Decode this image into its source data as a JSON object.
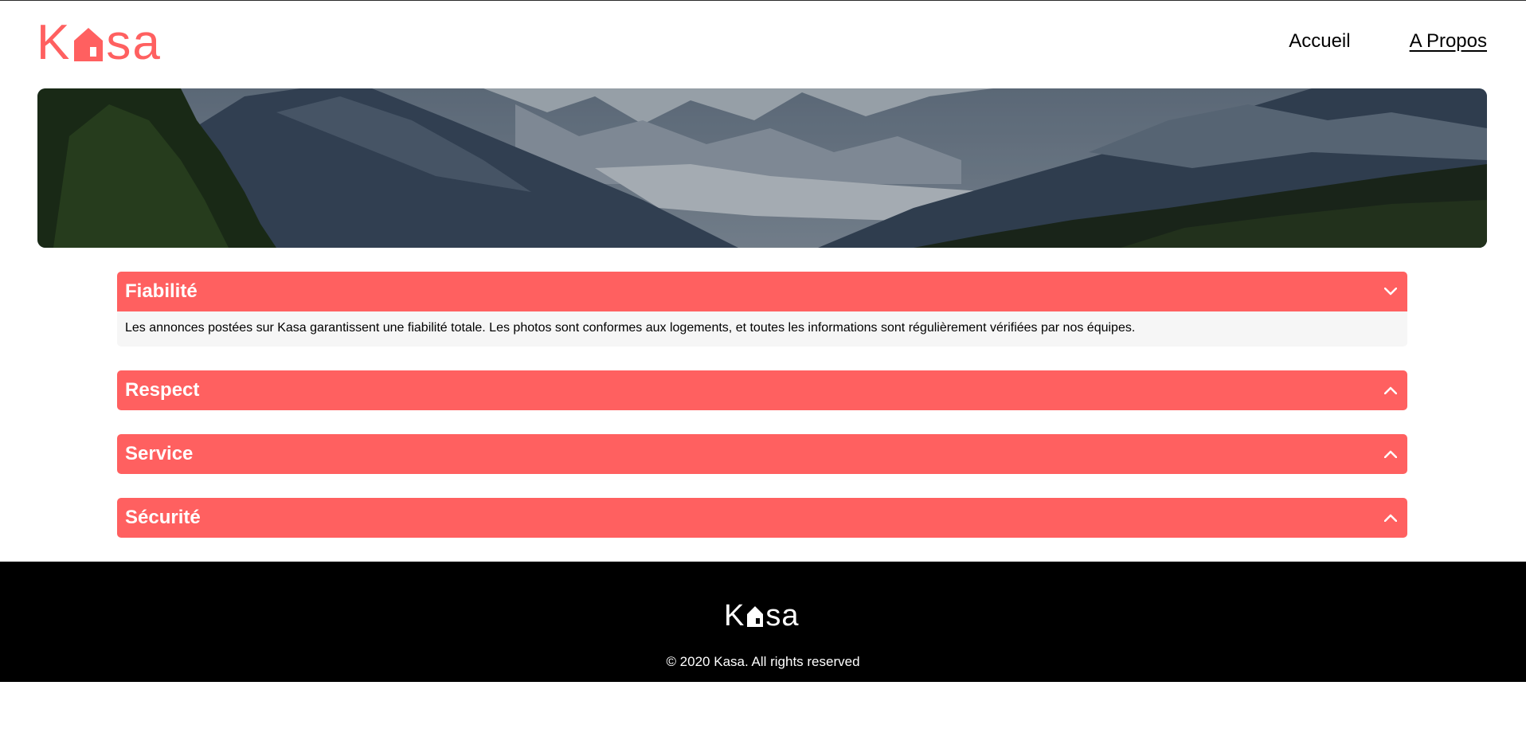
{
  "brand": {
    "logo_left": "K",
    "logo_right": "sa",
    "accent_color": "#FF6060"
  },
  "nav": {
    "items": [
      {
        "label": "Accueil"
      },
      {
        "label": "A Propos"
      }
    ],
    "active_index": 1
  },
  "banner": {
    "image": "mountain-landscape"
  },
  "accordion": {
    "items": [
      {
        "title": "Fiabilité",
        "state": "open",
        "icon": "chevron-down-icon",
        "content": "Les annonces postées sur Kasa garantissent une fiabilité totale. Les photos sont conformes aux logements, et toutes les informations sont régulièrement vérifiées par nos équipes."
      },
      {
        "title": "Respect",
        "state": "closed",
        "icon": "chevron-up-icon"
      },
      {
        "title": "Service",
        "state": "closed",
        "icon": "chevron-up-icon"
      },
      {
        "title": "Sécurité",
        "state": "closed",
        "icon": "chevron-up-icon"
      }
    ]
  },
  "footer": {
    "logo_left": "K",
    "logo_right": "sa",
    "copyright": "© 2020 Kasa. All rights reserved"
  }
}
